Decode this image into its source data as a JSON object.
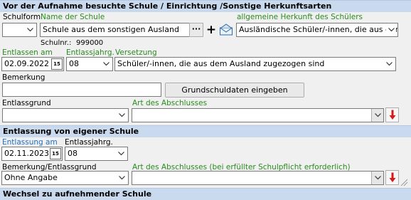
{
  "section1": {
    "title": "Vor der Aufnahme besuchte Schule / Einrichtung /Sonstige Herkunftsarten",
    "schulform_label": "Schulform",
    "schulform_value": "",
    "name_label": "Name der Schule",
    "name_value": "Schule aus dem sonstigen Ausland",
    "more_button": "···",
    "add_button": "+",
    "herkunft_label": "allgemeine Herkunft des Schülers",
    "herkunft_value": "Ausländische Schüler/-innen, die aus dem A",
    "schulnr_label": "Schulnr.:",
    "schulnr_value": "999000",
    "entlassen_label": "Entlassen am",
    "entlassen_value": "02.09.2022",
    "entlassjahrg_label": "Entlassjahrg.",
    "entlassjahrg_value": "08",
    "versetzung_label": "Versetzung",
    "versetzung_value": "Schüler/-innen, die aus dem Ausland zugezogen sind",
    "bemerkung_label": "Bemerkung",
    "bemerkung_value": "",
    "grundschul_button": "Grundschuldaten eingeben",
    "entlassgrund_label": "Entlassgrund",
    "entlassgrund_value": "",
    "abschluss_label": "Art des Abschlusses",
    "abschluss_value": ""
  },
  "section2": {
    "title": "Entlassung von eigener Schule",
    "entlassung_label": "Entlassung am",
    "entlassung_value": "02.11.2023",
    "entlassjahrg_label": "Entlassjahrg.",
    "entlassjahrg_value": "08",
    "bemerkung_label": "Bemerkung/Entlassgrund",
    "bemerkung_value": "Ohne Angabe",
    "abschluss_label": "Art des Abschlusses (bei erfüllter Schulpflicht erforderlich)",
    "abschluss_value": ""
  },
  "section3": {
    "title": "Wechsel zu aufnehmender Schule"
  },
  "icons": {
    "calendar": "calendar-icon",
    "envelope": "envelope-icon",
    "red_arrow": "red-down-arrow-icon",
    "chevron": "chevron-down-icon"
  },
  "colors": {
    "header_bg": "#c9d9ee",
    "label_green": "#2a8a1f",
    "label_blue": "#1f6fc4",
    "arrow_red": "#d41a1a"
  }
}
